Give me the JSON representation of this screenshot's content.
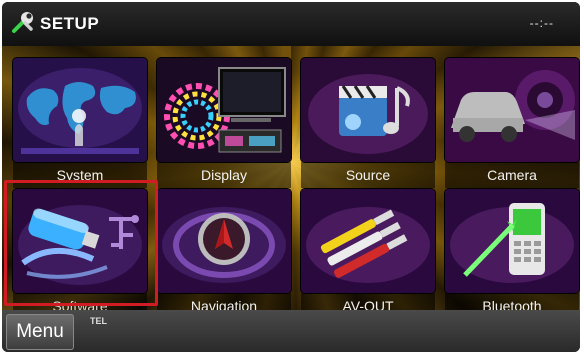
{
  "header": {
    "title": "SETUP",
    "clock": "--:--",
    "icon": "wrench-icon"
  },
  "tiles": [
    {
      "label": "System",
      "icon": "world-map-icon"
    },
    {
      "label": "Display",
      "icon": "display-icon"
    },
    {
      "label": "Source",
      "icon": "media-source-icon"
    },
    {
      "label": "Camera",
      "icon": "camera-icon"
    },
    {
      "label": "Software",
      "icon": "usb-drive-icon"
    },
    {
      "label": "Navigation",
      "icon": "compass-icon"
    },
    {
      "label": "AV-OUT",
      "icon": "av-cable-icon"
    },
    {
      "label": "Bluetooth",
      "icon": "phone-icon"
    }
  ],
  "bottombar": {
    "menu_label": "Menu",
    "tel_label": "TEL"
  },
  "colors": {
    "highlight": "#d21c24",
    "tile_bg": "#3a0f4a",
    "background_glow": "#e0a820"
  }
}
